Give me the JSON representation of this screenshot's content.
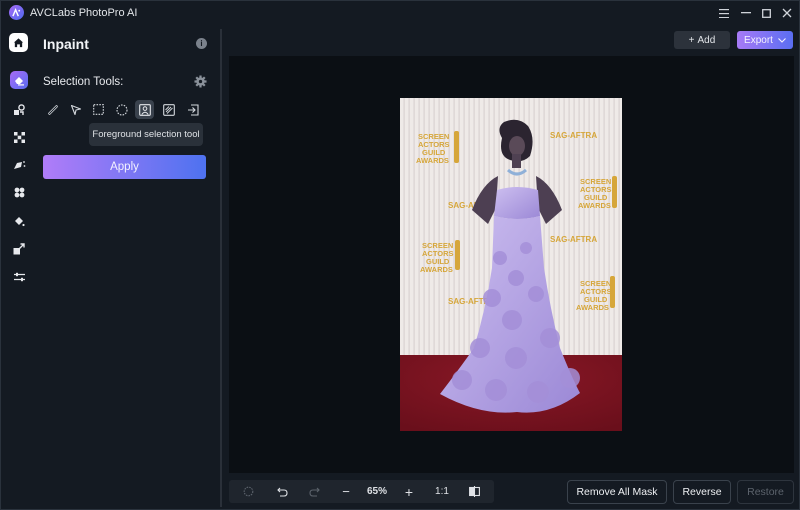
{
  "app": {
    "title": "AVCLabs PhotoPro AI",
    "window_controls": [
      "menu-icon",
      "minimize-icon",
      "maximize-icon",
      "close-icon"
    ]
  },
  "rail": {
    "items": [
      {
        "name": "home",
        "icon": "home-icon",
        "active": false
      },
      {
        "name": "inpaint",
        "icon": "eraser-icon",
        "active": true
      },
      {
        "name": "object-tool",
        "icon": "shapes-icon",
        "active": false
      },
      {
        "name": "pixel",
        "icon": "grid-icon",
        "active": false
      },
      {
        "name": "enhance",
        "icon": "sparkle-brush-icon",
        "active": false
      },
      {
        "name": "fan",
        "icon": "fan-icon",
        "active": false
      },
      {
        "name": "colorize",
        "icon": "paint-bucket-icon",
        "active": false
      },
      {
        "name": "upscale",
        "icon": "resize-icon",
        "active": false
      },
      {
        "name": "adjust",
        "icon": "sliders-icon",
        "active": false
      }
    ]
  },
  "panel": {
    "title": "Inpaint",
    "info_icon": "info-icon",
    "selection_label": "Selection Tools:",
    "settings_icon": "gear-icon",
    "tools": [
      {
        "name": "brush",
        "icon": "brush-icon",
        "active": false
      },
      {
        "name": "lasso",
        "icon": "pointer-icon",
        "active": false
      },
      {
        "name": "rectangle",
        "icon": "rectangle-select-icon",
        "active": false
      },
      {
        "name": "ellipse",
        "icon": "ellipse-select-icon",
        "active": false
      },
      {
        "name": "foreground",
        "icon": "person-select-icon",
        "active": true
      },
      {
        "name": "background",
        "icon": "hatch-select-icon",
        "active": false
      },
      {
        "name": "import",
        "icon": "import-icon",
        "active": false
      }
    ],
    "tooltip": "Foreground selection tool",
    "apply_label": "Apply"
  },
  "toolbar": {
    "add_label": "Add",
    "add_icon": "+",
    "export_label": "Export",
    "export_icon": "chevron-down-icon"
  },
  "zoombar": {
    "zoom_value": "65%",
    "one_to_one": "1:1",
    "minus": "−",
    "plus": "+"
  },
  "actions": {
    "remove_all_mask": "Remove All Mask",
    "reverse": "Reverse",
    "restore": "Restore"
  },
  "photo": {
    "backdrop_texts": [
      "SCREEN",
      "ACTORS",
      "GUILD",
      "AWARDS",
      "SAG-AFTRA"
    ],
    "colors": {
      "backdrop": "#ece6e4",
      "carpet": "#7e1422",
      "gown": "#b4a3e2",
      "gold": "#d9a93a"
    }
  }
}
